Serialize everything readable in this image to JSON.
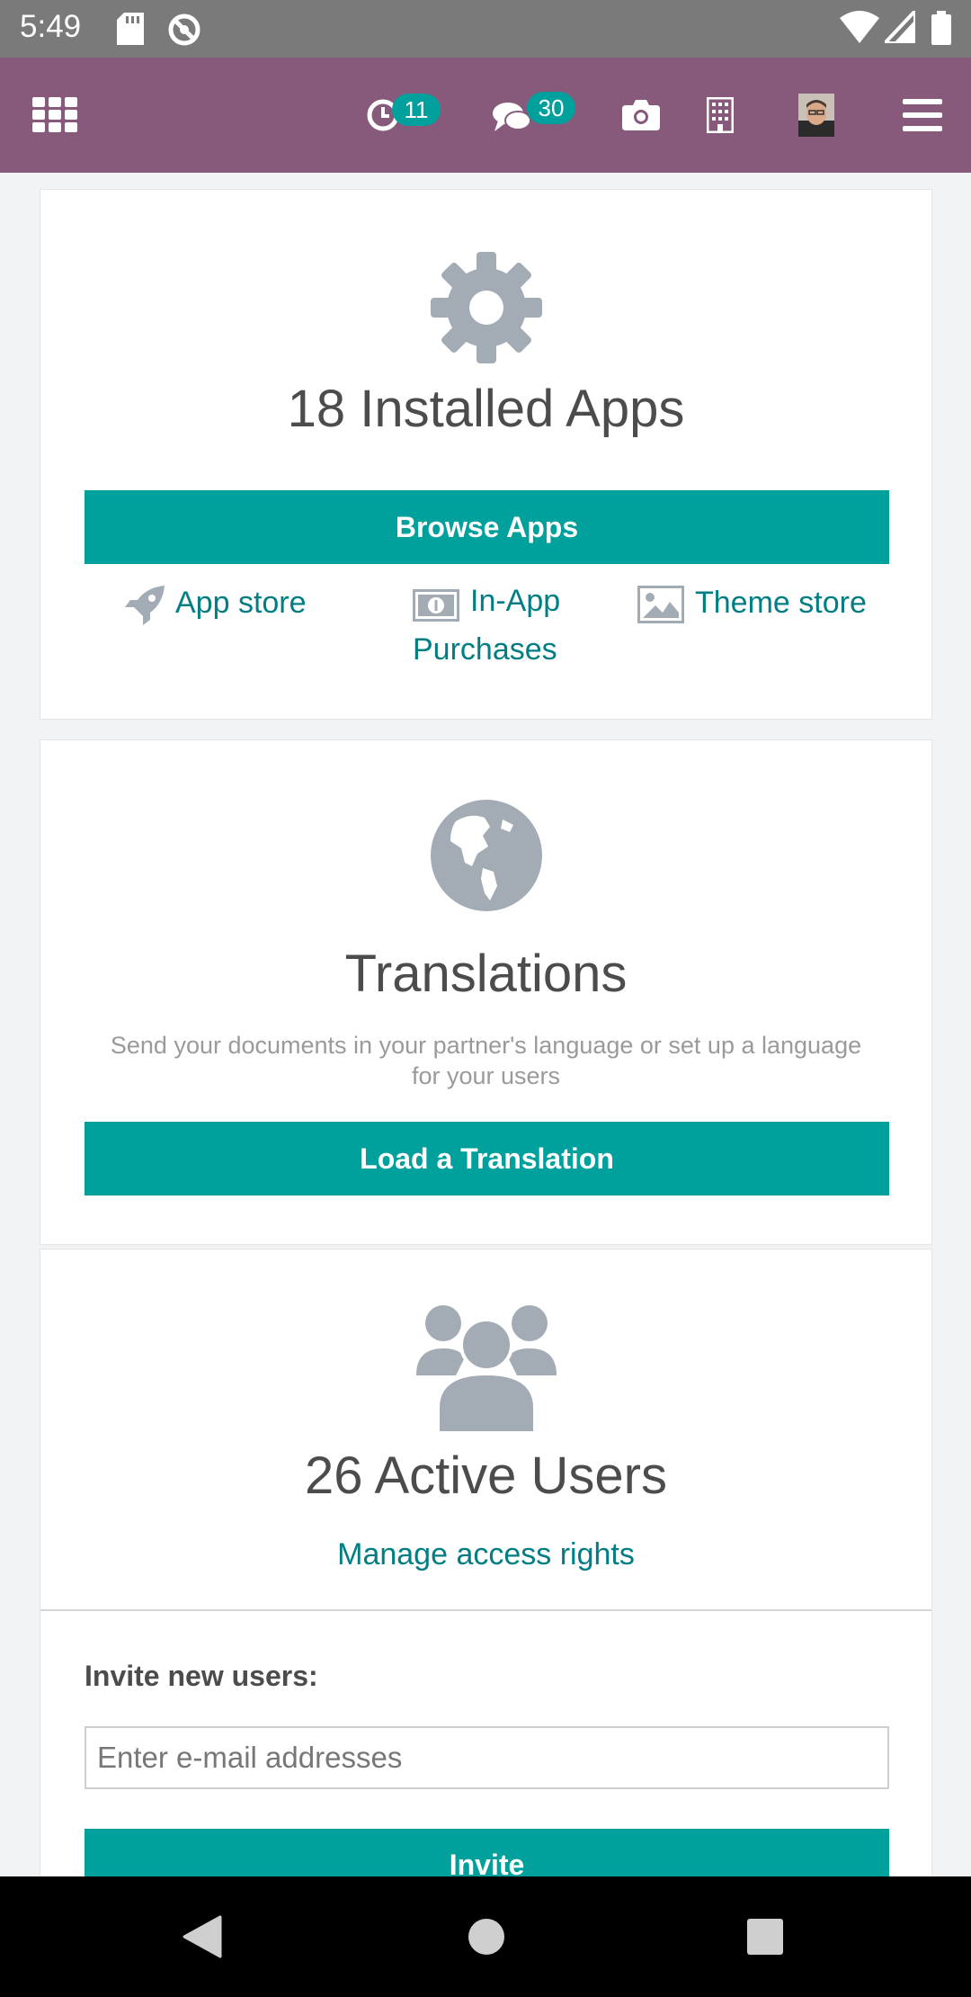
{
  "status_bar": {
    "time": "5:49",
    "icons": [
      "sd-card-icon",
      "at-sign-icon",
      "wifi-icon",
      "cell-signal-icon",
      "battery-icon"
    ]
  },
  "navbar": {
    "activity_count": "11",
    "messages_count": "30",
    "icons": [
      "apps-grid-icon",
      "clock-icon",
      "chat-icon",
      "camera-icon",
      "building-icon",
      "avatar",
      "hamburger-menu-icon"
    ]
  },
  "apps_card": {
    "title": "18 Installed Apps",
    "browse_button": "Browse Apps",
    "app_store": "App store",
    "in_app_line1": "In-App",
    "in_app_line2": "Purchases",
    "theme_store": "Theme store"
  },
  "translations_card": {
    "title": "Translations",
    "description_line1": "Send your documents in your partner's language or set up a language",
    "description_line2": "for your users",
    "load_button": "Load a Translation"
  },
  "users_card": {
    "title": "26 Active Users",
    "manage_link": "Manage access rights",
    "invite_label": "Invite new users:",
    "invite_placeholder": "Enter e-mail addresses",
    "invite_button": "Invite"
  },
  "colors": {
    "navbar": "#875a7b",
    "primary": "#00a09d",
    "link": "#017e84",
    "icon_gray": "#a3abb4"
  }
}
